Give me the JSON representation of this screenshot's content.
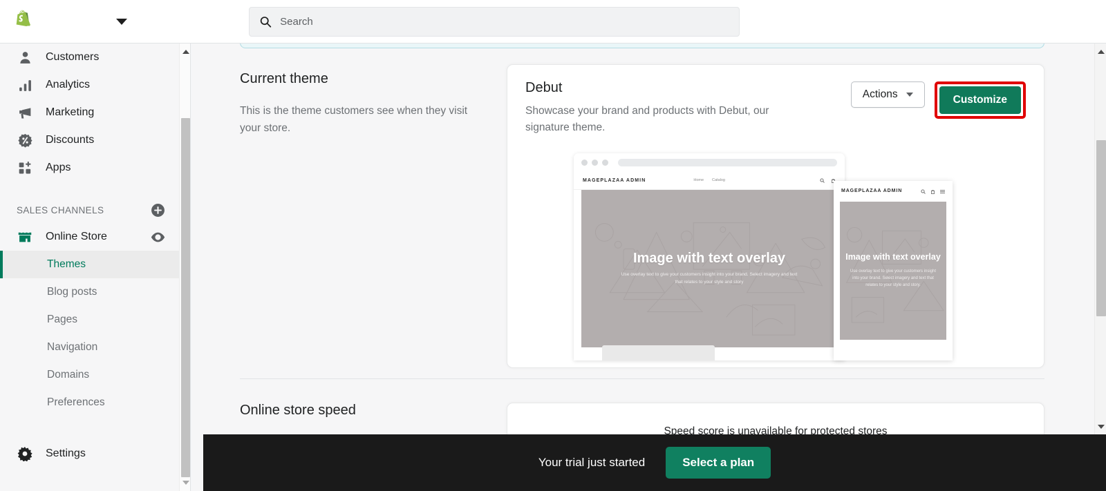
{
  "topbar": {
    "logo_icon": "shopify-bag-logo",
    "store_name": "",
    "chevron_icon": "chevron-down-icon",
    "search": {
      "icon": "search-icon",
      "placeholder": "Search",
      "value": ""
    }
  },
  "sidebar": {
    "nav_items": [
      {
        "label": "Customers",
        "icon": "person-icon"
      },
      {
        "label": "Analytics",
        "icon": "bar-chart-icon"
      },
      {
        "label": "Marketing",
        "icon": "megaphone-icon"
      },
      {
        "label": "Discounts",
        "icon": "discount-tag-icon"
      },
      {
        "label": "Apps",
        "icon": "apps-grid-plus-icon"
      }
    ],
    "sales_channels": {
      "title": "SALES CHANNELS",
      "add_icon": "plus-circle-icon",
      "channel": {
        "label": "Online Store",
        "icon": "storefront-icon",
        "view_icon": "eye-icon"
      },
      "sub_items": [
        {
          "label": "Themes",
          "active": true
        },
        {
          "label": "Blog posts",
          "active": false
        },
        {
          "label": "Pages",
          "active": false
        },
        {
          "label": "Navigation",
          "active": false
        },
        {
          "label": "Domains",
          "active": false
        },
        {
          "label": "Preferences",
          "active": false
        }
      ]
    },
    "settings": {
      "label": "Settings",
      "icon": "gear-icon"
    }
  },
  "main": {
    "current_theme": {
      "title": "Current theme",
      "description": "This is the theme customers see when they visit your store."
    },
    "theme_card": {
      "name": "Debut",
      "description": "Showcase your brand and products with Debut, our signature theme.",
      "actions_button": {
        "label": "Actions",
        "chevron_icon": "chevron-down-icon"
      },
      "customize_button": {
        "label": "Customize",
        "color": "#107a5a",
        "highlight_color": "#e00000"
      }
    },
    "preview": {
      "desktop": {
        "brand": "MAGEPLAZAA ADMIN",
        "nav_links": [
          "Home",
          "Catalog"
        ],
        "icons": [
          "search-icon",
          "cart-icon"
        ],
        "hero_heading": "Image with text overlay",
        "hero_text": "Use overlay text to give your customers insight into your brand. Select imagery and text that relates to your style and story"
      },
      "mobile": {
        "brand": "MAGEPLAZAA ADMIN",
        "icons": [
          "search-icon",
          "cart-icon",
          "hamburger-menu-icon"
        ],
        "hero_heading": "Image with text overlay",
        "hero_text": "Use overlay text to give your customers insight into your brand. Select imagery and text that relates to your style and story."
      }
    },
    "section_two": {
      "title": "Online store speed",
      "card_text": "Speed score is unavailable for protected stores"
    }
  },
  "trial_bar": {
    "message": "Your trial just started",
    "button_label": "Select a plan",
    "button_color": "#108060",
    "background": "#1a1a1a"
  }
}
